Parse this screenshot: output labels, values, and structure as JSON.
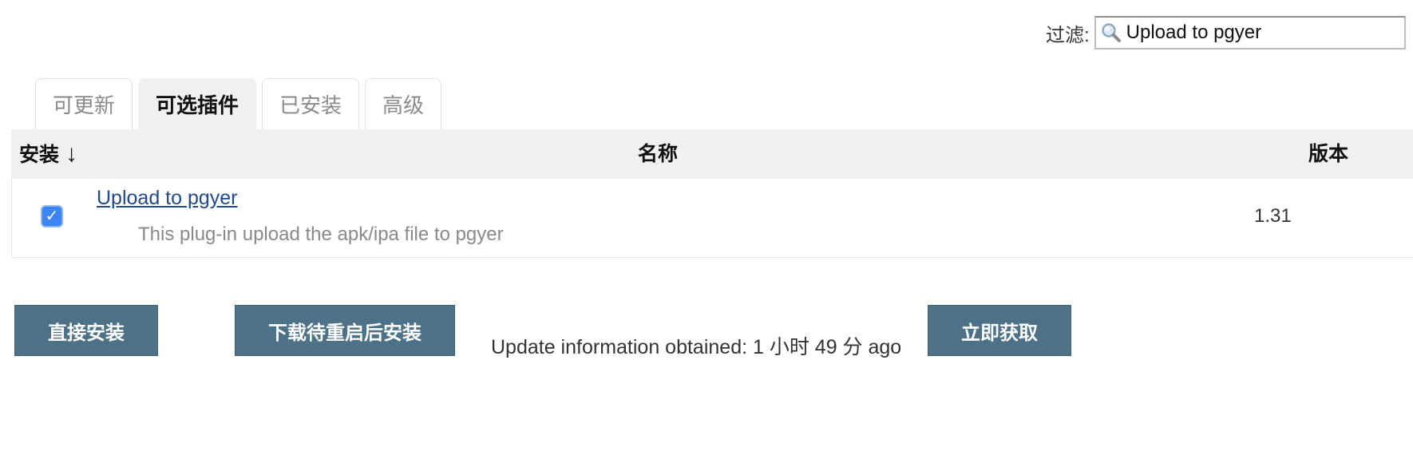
{
  "filter": {
    "label": "过滤:",
    "value": "Upload to pgyer",
    "icon": "search-icon"
  },
  "tabs": [
    {
      "label": "可更新",
      "active": false
    },
    {
      "label": "可选插件",
      "active": true
    },
    {
      "label": "已安装",
      "active": false
    },
    {
      "label": "高级",
      "active": false
    }
  ],
  "table": {
    "headers": {
      "install": "安装",
      "sort_arrow": "↓",
      "name": "名称",
      "version": "版本"
    },
    "rows": [
      {
        "checked": true,
        "check_glyph": "✓",
        "name": "Upload to pgyer",
        "description": "This plug-in upload the apk/ipa file to pgyer",
        "version": "1.31"
      }
    ]
  },
  "actions": {
    "install_now": "直接安装",
    "install_after_restart": "下载待重启后安装",
    "update_info": "Update information obtained: 1 小时 49 分 ago",
    "fetch_now": "立即获取"
  },
  "colors": {
    "button_bg": "#4d7187",
    "checkbox_bg": "#3c86f4",
    "link": "#204a87",
    "header_bg": "#f0f0f0"
  }
}
